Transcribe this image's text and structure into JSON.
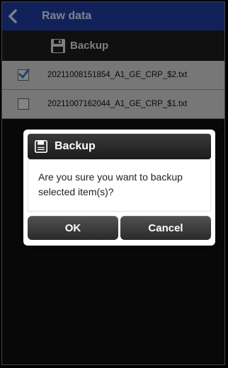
{
  "topbar": {
    "title": "Raw data"
  },
  "toolbar": {
    "backup_label": "Backup"
  },
  "files": [
    {
      "name": "20211008151854_A1_GE_CRP_$2.txt",
      "checked": true
    },
    {
      "name": "20211007162044_A1_GE_CRP_$1.txt",
      "checked": false
    }
  ],
  "dialog": {
    "title": "Backup",
    "message": "Are you sure you want to backup selected item(s)?",
    "ok_label": "OK",
    "cancel_label": "Cancel"
  },
  "colors": {
    "header": "#1f3fa6",
    "check": "#3b7bd6"
  }
}
